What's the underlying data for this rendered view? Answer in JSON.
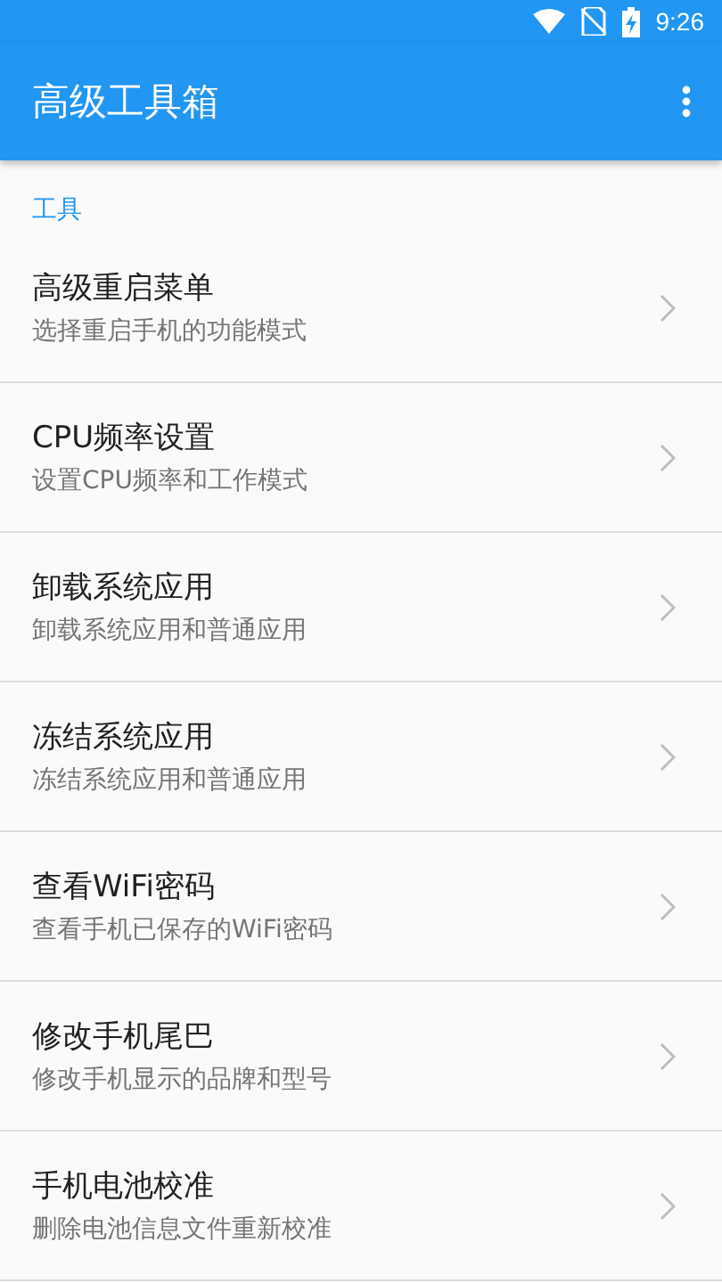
{
  "status_bar": {
    "time": "9:26"
  },
  "app_bar": {
    "title": "高级工具箱"
  },
  "section": {
    "header": "工具"
  },
  "items": [
    {
      "title": "高级重启菜单",
      "subtitle": "选择重启手机的功能模式"
    },
    {
      "title": "CPU频率设置",
      "subtitle": "设置CPU频率和工作模式"
    },
    {
      "title": "卸载系统应用",
      "subtitle": "卸载系统应用和普通应用"
    },
    {
      "title": "冻结系统应用",
      "subtitle": "冻结系统应用和普通应用"
    },
    {
      "title": "查看WiFi密码",
      "subtitle": "查看手机已保存的WiFi密码"
    },
    {
      "title": "修改手机尾巴",
      "subtitle": "修改手机显示的品牌和型号"
    },
    {
      "title": "手机电池校准",
      "subtitle": "删除电池信息文件重新校准"
    }
  ]
}
